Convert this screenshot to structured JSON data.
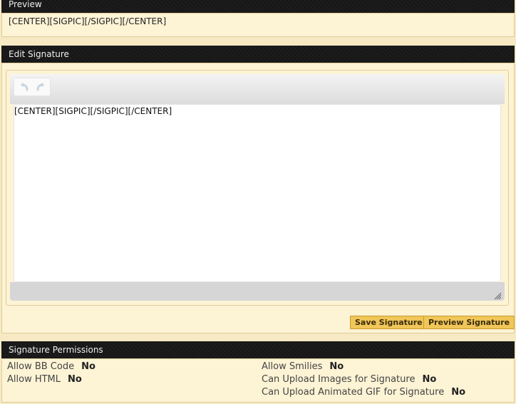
{
  "preview": {
    "title": "Preview",
    "content": "[CENTER][SIGPIC][/SIGPIC][/CENTER]"
  },
  "edit": {
    "title": "Edit Signature",
    "toolbar": {
      "undo_icon": "undo-icon",
      "redo_icon": "redo-icon"
    },
    "textarea_value": "[CENTER][SIGPIC][/SIGPIC][/CENTER]",
    "save_label": "Save Signature",
    "preview_label": "Preview Signature"
  },
  "permissions": {
    "title": "Signature Permissions",
    "left": [
      {
        "label": "Allow BB Code",
        "value": "No"
      },
      {
        "label": "Allow HTML",
        "value": "No"
      }
    ],
    "right": [
      {
        "label": "Allow Smilies",
        "value": "No"
      },
      {
        "label": "Can Upload Images for Signature",
        "value": "No"
      },
      {
        "label": "Can Upload Animated GIF for Signature",
        "value": "No"
      }
    ]
  },
  "colors": {
    "header_bg": "#161616",
    "panel_bg": "#fdf3d5",
    "button_bg": "#f0c659"
  }
}
